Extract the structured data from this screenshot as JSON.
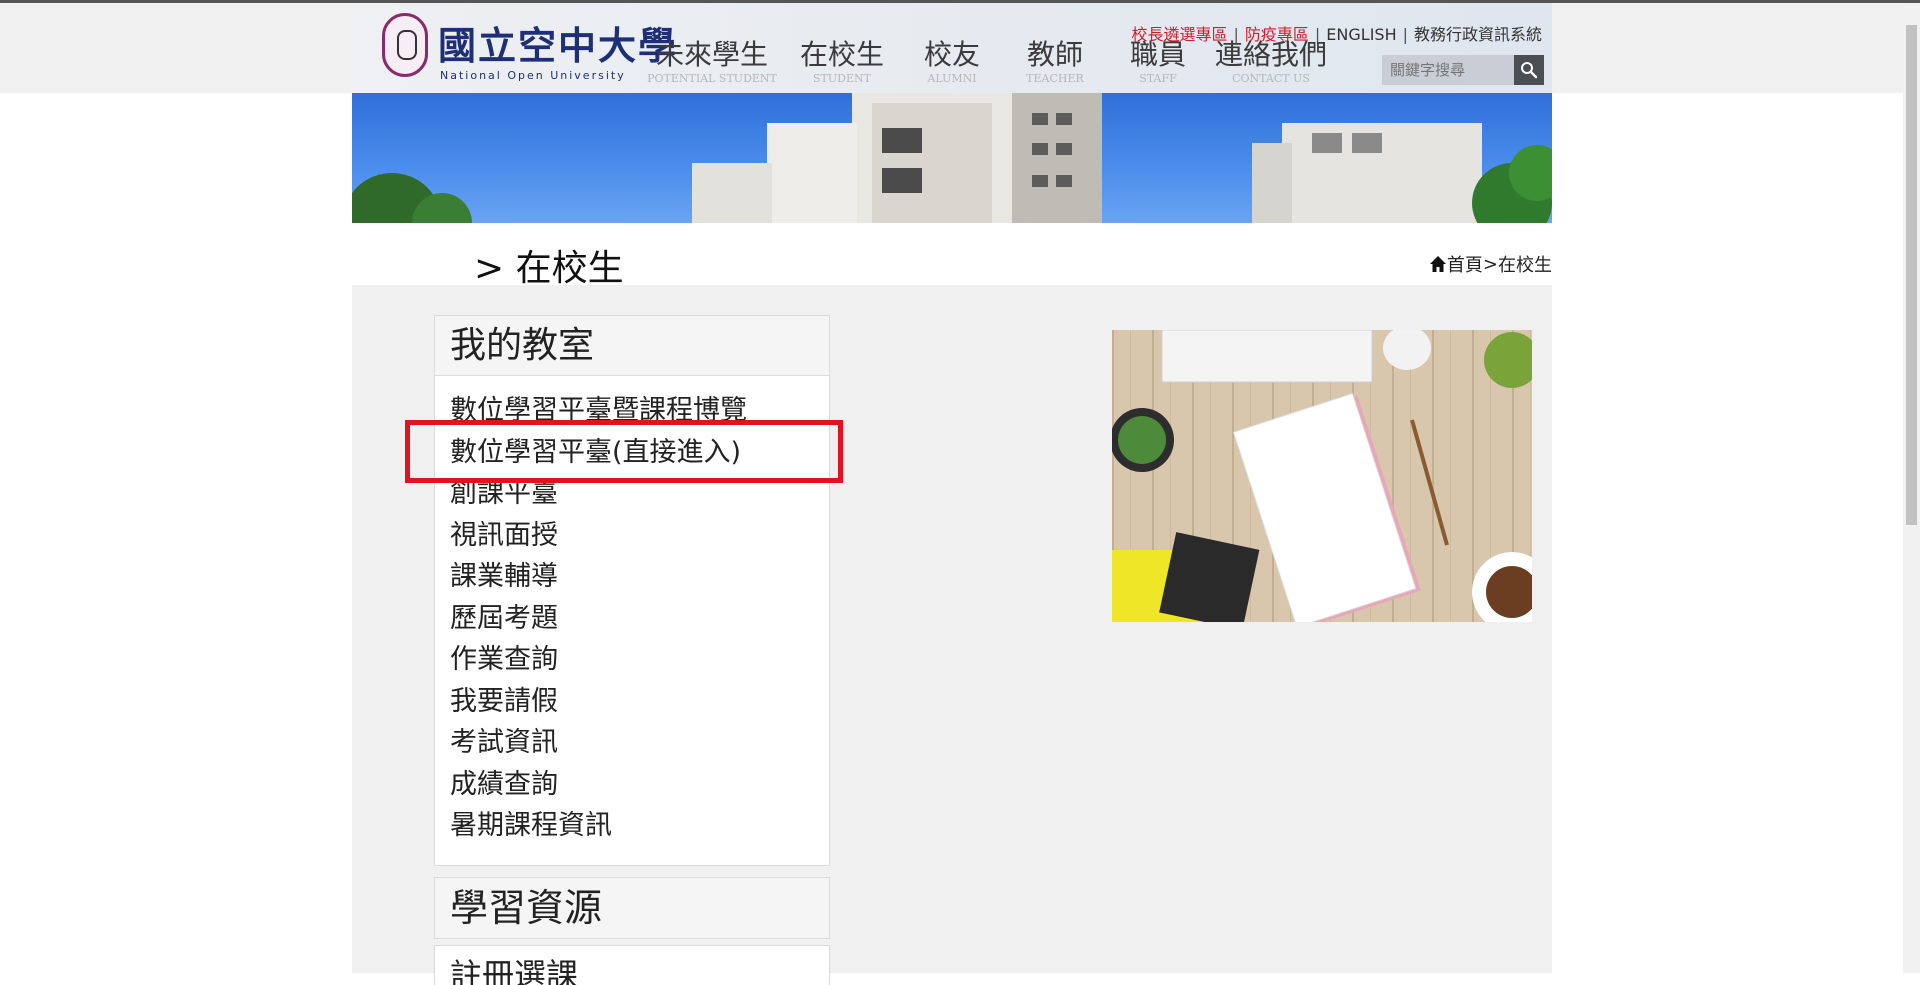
{
  "header": {
    "logo_cn": "國立空中大學",
    "logo_en": "National Open University",
    "util_links": [
      "校長遴選專區",
      "防疫專區",
      "ENGLISH",
      "教務行政資訊系統"
    ],
    "nav": [
      {
        "zh": "未來學生",
        "en": "POTENTIAL STUDENT"
      },
      {
        "zh": "在校生",
        "en": "STUDENT"
      },
      {
        "zh": "校友",
        "en": "ALUMNI"
      },
      {
        "zh": "教師",
        "en": "TEACHER"
      },
      {
        "zh": "職員",
        "en": "STAFF"
      },
      {
        "zh": "連絡我們",
        "en": "CONTACT US"
      }
    ],
    "search_placeholder": "關鍵字搜尋"
  },
  "title": {
    "page_title": "> 在校生",
    "breadcrumb_home": "首頁",
    "breadcrumb_sep": ">",
    "breadcrumb_current": "在校生"
  },
  "sidebar": {
    "panel1_title": "我的教室",
    "items": [
      "數位學習平臺暨課程博覽",
      "數位學習平臺(直接進入)",
      "創課平臺",
      "視訊面授",
      "課業輔導",
      "歷屆考題",
      "作業查詢",
      "我要請假",
      "考試資訊",
      "成績查詢",
      "暑期課程資訊"
    ],
    "panel2_title": "學習資源",
    "panel3_title": "註冊選課"
  },
  "colors": {
    "red_link": "#d01c2b",
    "highlight": "#e0141e",
    "logo_blue": "#1e2f78",
    "content_bg": "#f0f0f0"
  }
}
